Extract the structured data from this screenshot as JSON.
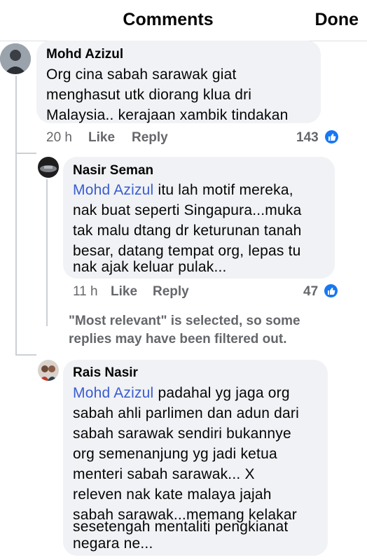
{
  "header": {
    "title": "Comments",
    "done_label": "Done"
  },
  "actions": {
    "like": "Like",
    "reply": "Reply"
  },
  "comments": [
    {
      "author": "Mohd Azizul",
      "lines": [
        "Org cina sabah sarawak giat",
        "menghasut utk diorang klua dri",
        "Malaysia.. kerajaan xambik tindakan"
      ],
      "time": "20 h",
      "reactions": "143"
    },
    {
      "author": "Nasir Seman",
      "mention": "Mohd Azizul",
      "first_line_rest": " itu lah motif mereka,",
      "lines": [
        "nak buat seperti Singapura...muka",
        "tak malu dtang dr keturunan tanah",
        "besar, datang tempat org, lepas tu",
        "nak ajak keluar pulak..."
      ],
      "time": "11 h",
      "reactions": "47"
    },
    {
      "author": "Rais Nasir",
      "mention": "Mohd Azizul",
      "first_line_rest": " padahal yg jaga org",
      "lines": [
        "sabah ahli parlimen dan adun dari",
        "sabah sarawak sendiri bukannye",
        "org semenanjung yg jadi ketua",
        "menteri sabah sarawak... X",
        "releven nak kate malaya jajah",
        "sabah sarawak...memang kelakar",
        "sesetengah mentaliti pengkianat",
        "negara ne..."
      ]
    }
  ],
  "filter_note": [
    "\"Most relevant\" is selected, so some",
    "replies may have been filtered out."
  ],
  "colors": {
    "mention": "#3a5cd0",
    "reaction_badge": "#1877f2",
    "bubble": "#f0f2f5"
  }
}
